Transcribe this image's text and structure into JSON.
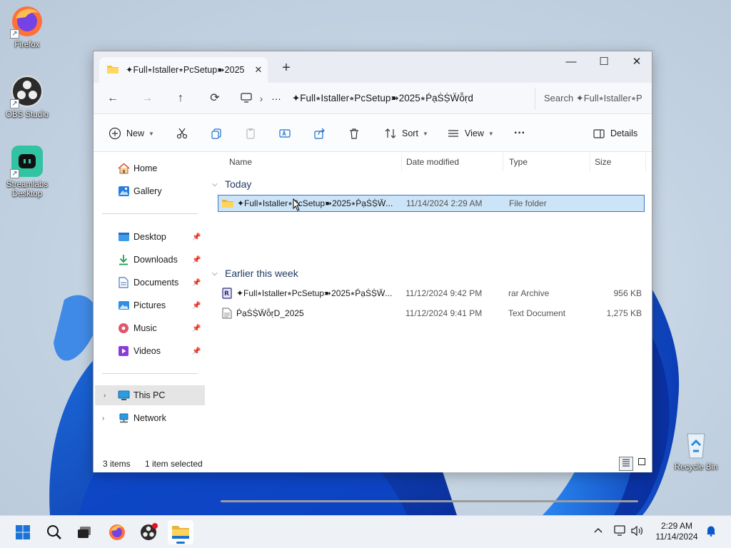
{
  "desktop": {
    "icons": [
      {
        "label": "Firefox"
      },
      {
        "label": "OBS Studio"
      },
      {
        "label": "Streamlabs Desktop"
      },
      {
        "label": "Recycle Bin"
      }
    ]
  },
  "window": {
    "tab_title": "✦Full⭒Istaller⭒PcSetup➽2025",
    "tab_close": "✕",
    "new_tab": "+",
    "controls": {
      "minimize": "—",
      "maximize": "☐",
      "close": "✕"
    },
    "nav": {
      "back": "←",
      "forward": "→",
      "up": "↑",
      "refresh": "⟳"
    },
    "breadcrumb": {
      "separator": "›",
      "more": "···",
      "current": "✦Full⭒Istaller⭒PcSetup➽2025⭒ṔạṠṨẄỗṛd"
    },
    "search_placeholder": "Search ✦Full⭒Istaller⭒P",
    "toolbar": {
      "new": "New",
      "sort": "Sort",
      "view": "View",
      "more": "···",
      "details": "Details"
    },
    "sidebar": {
      "quick": [
        {
          "label": "Home",
          "icon": "home-icon"
        },
        {
          "label": "Gallery",
          "icon": "gallery-icon"
        }
      ],
      "pinned": [
        {
          "label": "Desktop",
          "icon": "desktop-folder-icon"
        },
        {
          "label": "Downloads",
          "icon": "downloads-icon"
        },
        {
          "label": "Documents",
          "icon": "documents-icon"
        },
        {
          "label": "Pictures",
          "icon": "pictures-icon"
        },
        {
          "label": "Music",
          "icon": "music-icon"
        },
        {
          "label": "Videos",
          "icon": "videos-icon"
        }
      ],
      "locations": [
        {
          "label": "This PC",
          "icon": "this-pc-icon",
          "selected": true
        },
        {
          "label": "Network",
          "icon": "network-icon",
          "selected": false
        }
      ]
    },
    "columns": {
      "name": "Name",
      "date": "Date modified",
      "type": "Type",
      "size": "Size"
    },
    "groups": [
      {
        "label": "Today",
        "items": [
          {
            "name": "✦Full⭒Istaller⭒PcSetup➽2025⭒ṔạṠṨẄ...",
            "date": "11/14/2024 2:29 AM",
            "type": "File folder",
            "size": "",
            "icon": "folder-icon",
            "selected": true
          }
        ]
      },
      {
        "label": "Earlier this week",
        "items": [
          {
            "name": "✦Full⭒Istaller⭒PcSetup➽2025⭒ṔạṠṨẄ...",
            "date": "11/12/2024 9:42 PM",
            "type": "rar Archive",
            "size": "956 KB",
            "icon": "rar-archive-icon",
            "selected": false
          },
          {
            "name": "ṔạṠṨẄỗṛD_2025",
            "date": "11/12/2024 9:41 PM",
            "type": "Text Document",
            "size": "1,275 KB",
            "icon": "text-document-icon",
            "selected": false
          }
        ]
      }
    ],
    "status": {
      "count": "3 items",
      "selection": "1 item selected"
    }
  },
  "taskbar": {
    "clock_time": "2:29 AM",
    "clock_date": "11/14/2024",
    "tray_chevron": "^"
  }
}
